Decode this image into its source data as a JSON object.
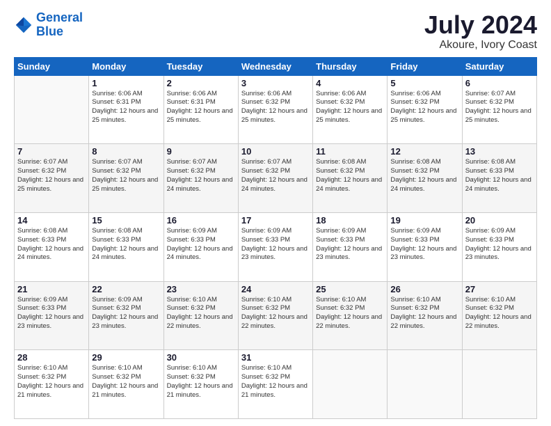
{
  "logo": {
    "line1": "General",
    "line2": "Blue"
  },
  "title": "July 2024",
  "location": "Akoure, Ivory Coast",
  "headers": [
    "Sunday",
    "Monday",
    "Tuesday",
    "Wednesday",
    "Thursday",
    "Friday",
    "Saturday"
  ],
  "weeks": [
    [
      {
        "num": "",
        "sunrise": "",
        "sunset": "",
        "daylight": ""
      },
      {
        "num": "1",
        "sunrise": "Sunrise: 6:06 AM",
        "sunset": "Sunset: 6:31 PM",
        "daylight": "Daylight: 12 hours and 25 minutes."
      },
      {
        "num": "2",
        "sunrise": "Sunrise: 6:06 AM",
        "sunset": "Sunset: 6:31 PM",
        "daylight": "Daylight: 12 hours and 25 minutes."
      },
      {
        "num": "3",
        "sunrise": "Sunrise: 6:06 AM",
        "sunset": "Sunset: 6:32 PM",
        "daylight": "Daylight: 12 hours and 25 minutes."
      },
      {
        "num": "4",
        "sunrise": "Sunrise: 6:06 AM",
        "sunset": "Sunset: 6:32 PM",
        "daylight": "Daylight: 12 hours and 25 minutes."
      },
      {
        "num": "5",
        "sunrise": "Sunrise: 6:06 AM",
        "sunset": "Sunset: 6:32 PM",
        "daylight": "Daylight: 12 hours and 25 minutes."
      },
      {
        "num": "6",
        "sunrise": "Sunrise: 6:07 AM",
        "sunset": "Sunset: 6:32 PM",
        "daylight": "Daylight: 12 hours and 25 minutes."
      }
    ],
    [
      {
        "num": "7",
        "sunrise": "Sunrise: 6:07 AM",
        "sunset": "Sunset: 6:32 PM",
        "daylight": "Daylight: 12 hours and 25 minutes."
      },
      {
        "num": "8",
        "sunrise": "Sunrise: 6:07 AM",
        "sunset": "Sunset: 6:32 PM",
        "daylight": "Daylight: 12 hours and 25 minutes."
      },
      {
        "num": "9",
        "sunrise": "Sunrise: 6:07 AM",
        "sunset": "Sunset: 6:32 PM",
        "daylight": "Daylight: 12 hours and 24 minutes."
      },
      {
        "num": "10",
        "sunrise": "Sunrise: 6:07 AM",
        "sunset": "Sunset: 6:32 PM",
        "daylight": "Daylight: 12 hours and 24 minutes."
      },
      {
        "num": "11",
        "sunrise": "Sunrise: 6:08 AM",
        "sunset": "Sunset: 6:32 PM",
        "daylight": "Daylight: 12 hours and 24 minutes."
      },
      {
        "num": "12",
        "sunrise": "Sunrise: 6:08 AM",
        "sunset": "Sunset: 6:32 PM",
        "daylight": "Daylight: 12 hours and 24 minutes."
      },
      {
        "num": "13",
        "sunrise": "Sunrise: 6:08 AM",
        "sunset": "Sunset: 6:33 PM",
        "daylight": "Daylight: 12 hours and 24 minutes."
      }
    ],
    [
      {
        "num": "14",
        "sunrise": "Sunrise: 6:08 AM",
        "sunset": "Sunset: 6:33 PM",
        "daylight": "Daylight: 12 hours and 24 minutes."
      },
      {
        "num": "15",
        "sunrise": "Sunrise: 6:08 AM",
        "sunset": "Sunset: 6:33 PM",
        "daylight": "Daylight: 12 hours and 24 minutes."
      },
      {
        "num": "16",
        "sunrise": "Sunrise: 6:09 AM",
        "sunset": "Sunset: 6:33 PM",
        "daylight": "Daylight: 12 hours and 24 minutes."
      },
      {
        "num": "17",
        "sunrise": "Sunrise: 6:09 AM",
        "sunset": "Sunset: 6:33 PM",
        "daylight": "Daylight: 12 hours and 23 minutes."
      },
      {
        "num": "18",
        "sunrise": "Sunrise: 6:09 AM",
        "sunset": "Sunset: 6:33 PM",
        "daylight": "Daylight: 12 hours and 23 minutes."
      },
      {
        "num": "19",
        "sunrise": "Sunrise: 6:09 AM",
        "sunset": "Sunset: 6:33 PM",
        "daylight": "Daylight: 12 hours and 23 minutes."
      },
      {
        "num": "20",
        "sunrise": "Sunrise: 6:09 AM",
        "sunset": "Sunset: 6:33 PM",
        "daylight": "Daylight: 12 hours and 23 minutes."
      }
    ],
    [
      {
        "num": "21",
        "sunrise": "Sunrise: 6:09 AM",
        "sunset": "Sunset: 6:33 PM",
        "daylight": "Daylight: 12 hours and 23 minutes."
      },
      {
        "num": "22",
        "sunrise": "Sunrise: 6:09 AM",
        "sunset": "Sunset: 6:32 PM",
        "daylight": "Daylight: 12 hours and 23 minutes."
      },
      {
        "num": "23",
        "sunrise": "Sunrise: 6:10 AM",
        "sunset": "Sunset: 6:32 PM",
        "daylight": "Daylight: 12 hours and 22 minutes."
      },
      {
        "num": "24",
        "sunrise": "Sunrise: 6:10 AM",
        "sunset": "Sunset: 6:32 PM",
        "daylight": "Daylight: 12 hours and 22 minutes."
      },
      {
        "num": "25",
        "sunrise": "Sunrise: 6:10 AM",
        "sunset": "Sunset: 6:32 PM",
        "daylight": "Daylight: 12 hours and 22 minutes."
      },
      {
        "num": "26",
        "sunrise": "Sunrise: 6:10 AM",
        "sunset": "Sunset: 6:32 PM",
        "daylight": "Daylight: 12 hours and 22 minutes."
      },
      {
        "num": "27",
        "sunrise": "Sunrise: 6:10 AM",
        "sunset": "Sunset: 6:32 PM",
        "daylight": "Daylight: 12 hours and 22 minutes."
      }
    ],
    [
      {
        "num": "28",
        "sunrise": "Sunrise: 6:10 AM",
        "sunset": "Sunset: 6:32 PM",
        "daylight": "Daylight: 12 hours and 21 minutes."
      },
      {
        "num": "29",
        "sunrise": "Sunrise: 6:10 AM",
        "sunset": "Sunset: 6:32 PM",
        "daylight": "Daylight: 12 hours and 21 minutes."
      },
      {
        "num": "30",
        "sunrise": "Sunrise: 6:10 AM",
        "sunset": "Sunset: 6:32 PM",
        "daylight": "Daylight: 12 hours and 21 minutes."
      },
      {
        "num": "31",
        "sunrise": "Sunrise: 6:10 AM",
        "sunset": "Sunset: 6:32 PM",
        "daylight": "Daylight: 12 hours and 21 minutes."
      },
      {
        "num": "",
        "sunrise": "",
        "sunset": "",
        "daylight": ""
      },
      {
        "num": "",
        "sunrise": "",
        "sunset": "",
        "daylight": ""
      },
      {
        "num": "",
        "sunrise": "",
        "sunset": "",
        "daylight": ""
      }
    ]
  ]
}
